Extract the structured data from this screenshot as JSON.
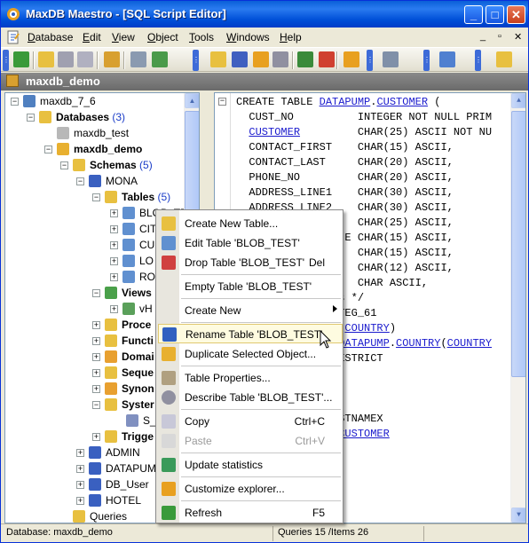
{
  "window": {
    "title": "MaxDB Maestro - [SQL Script Editor]",
    "controls": {
      "minimize": "_",
      "maximize": "□",
      "close": "✕"
    }
  },
  "menubar": {
    "items": [
      {
        "label": "Database",
        "accel": "D"
      },
      {
        "label": "Edit",
        "accel": "E"
      },
      {
        "label": "View",
        "accel": "V"
      },
      {
        "label": "Object",
        "accel": "O"
      },
      {
        "label": "Tools",
        "accel": "T"
      },
      {
        "label": "Windows",
        "accel": "W"
      },
      {
        "label": "Help",
        "accel": "H"
      }
    ],
    "mdi_controls": {
      "minimize": "_",
      "restore": "▫",
      "close": "✕"
    }
  },
  "tab": {
    "title": "maxdb_demo"
  },
  "tree": {
    "root": "maxdb_7_6",
    "databases_label": "Databases",
    "databases_count": "(3)",
    "db_test": "maxdb_test",
    "db_demo": "maxdb_demo",
    "schemas_label": "Schemas",
    "schemas_count": "(5)",
    "schema_mona": "MONA",
    "tables_label": "Tables",
    "tables_count": "(5)",
    "table_items": [
      "BLOB_TE",
      "CITY",
      "CU",
      "LO",
      "RO"
    ],
    "views_label": "Views",
    "view_item": "vH",
    "procedures_label": "Proce",
    "functions_label": "Functi",
    "domains_label": "Domai",
    "sequences_label": "Seque",
    "synonyms_label": "Synon",
    "system_label": "Syster",
    "system_child": "S_t",
    "triggers_label": "Trigge",
    "schema_admin": "ADMIN",
    "schema_datapump": "DATAPUMP",
    "schema_dbuser": "DB_User",
    "schema_hotel": "HOTEL",
    "queries_label": "Queries"
  },
  "editor": {
    "lines": [
      {
        "pre": "CREATE TABLE ",
        "link1": "DATAPUMP",
        "mid": ".",
        "link2": "CUSTOMER",
        "post": " ("
      },
      {
        "text": "  CUST_NO          INTEGER NOT NULL PRIM"
      },
      {
        "link": "CUSTOMER",
        "pre": "  ",
        "post": "         CHAR(25) ASCII NOT NU"
      },
      {
        "text": "  CONTACT_FIRST    CHAR(15) ASCII,"
      },
      {
        "text": "  CONTACT_LAST     CHAR(20) ASCII,"
      },
      {
        "text": "  PHONE_NO         CHAR(20) ASCII,"
      },
      {
        "text": "  ADDRESS_LINE1    CHAR(30) ASCII,"
      },
      {
        "text": "  ADDRESS_LINE2    CHAR(30) ASCII,"
      },
      {
        "text": "                   CHAR(25) ASCII,"
      },
      {
        "text": "                 E CHAR(15) ASCII,"
      },
      {
        "text": "                   CHAR(15) ASCII,"
      },
      {
        "text": "                   CHAR(12) ASCII,"
      },
      {
        "text": "                   CHAR ASCII,"
      },
      {
        "text": "               ys */"
      },
      {
        "text": "                TEG_61"
      },
      {
        "pre": "                (",
        "link": "COUNTRY",
        "post": ")"
      },
      {
        "pre": "                ",
        "link1": "DATAPUMP",
        "mid": ".",
        "link2": "COUNTRY",
        "post": "(",
        "link3": "COUNTRY"
      },
      {
        "text": "                ESTRICT"
      },
      {
        "text": ""
      },
      {
        "text": ""
      },
      {
        "text": ""
      },
      {
        "text": "                STNAMEX"
      },
      {
        "pre": "                ",
        "link": "CUSTOMER"
      }
    ]
  },
  "context_menu": {
    "items": [
      {
        "label": "Create New Table...",
        "key": ""
      },
      {
        "label": "Edit Table 'BLOB_TEST'",
        "key": ""
      },
      {
        "label": "Drop Table 'BLOB_TEST'",
        "key": "Del"
      },
      {
        "label": "Empty Table 'BLOB_TEST'",
        "key": ""
      },
      {
        "label": "Create New",
        "key": ""
      },
      {
        "label": "Rename Table 'BLOB_TEST'",
        "key": ""
      },
      {
        "label": "Duplicate Selected Object...",
        "key": ""
      },
      {
        "label": "Table Properties...",
        "key": ""
      },
      {
        "label": "Describe Table 'BLOB_TEST'...",
        "key": ""
      },
      {
        "label": "Copy",
        "key": "Ctrl+C"
      },
      {
        "label": "Paste",
        "key": "Ctrl+V"
      },
      {
        "label": "Update statistics",
        "key": ""
      },
      {
        "label": "Customize explorer...",
        "key": ""
      },
      {
        "label": "Refresh",
        "key": "F5"
      }
    ]
  },
  "statusbar": {
    "database": "Database: maxdb_demo",
    "queries": "Queries 15 /Items 26"
  },
  "colors": {
    "titlebar": "#0a5fd8",
    "highlight": "#fefbe0",
    "link": "#1a1acd"
  }
}
